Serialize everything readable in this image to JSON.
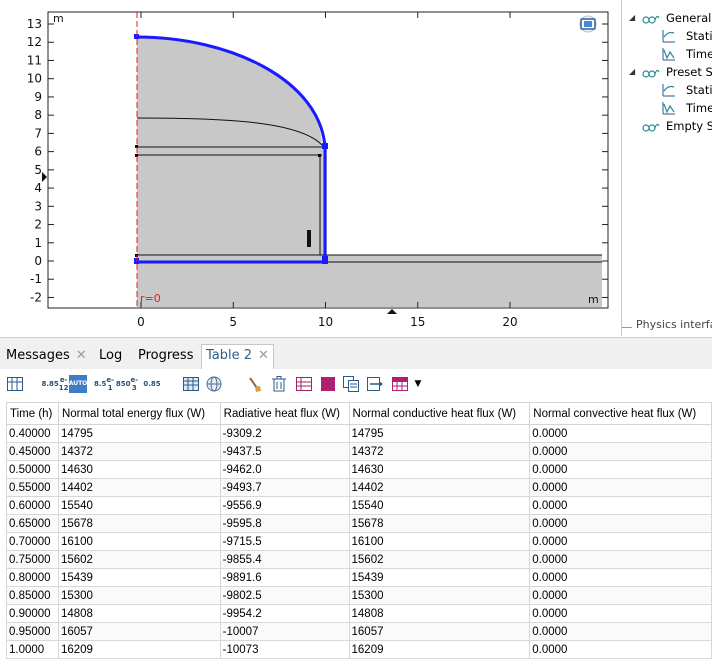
{
  "graphics": {
    "unit_top": "m",
    "unit_right": "m",
    "axis_label": "r=0",
    "y_ticks": [
      "13",
      "12",
      "11",
      "10",
      "9",
      "8",
      "7",
      "6",
      "5",
      "4",
      "3",
      "2",
      "1",
      "0",
      "-1",
      "-2"
    ],
    "x_ticks": [
      "0",
      "5",
      "10",
      "15",
      "20"
    ]
  },
  "tree": {
    "items": [
      {
        "label": "General S",
        "icon": "study-icon",
        "expand": true
      },
      {
        "label": "Statio",
        "icon": "stationary-solver-icon"
      },
      {
        "label": "Time",
        "icon": "time-dependent-icon"
      },
      {
        "label": "Preset Stu",
        "icon": "study-icon",
        "expand": true
      },
      {
        "label": "Statio",
        "icon": "stationary-solver-icon"
      },
      {
        "label": "Time",
        "icon": "time-dependent-icon"
      },
      {
        "label": "Empty St",
        "icon": "study-icon"
      }
    ],
    "physics_label": "Physics interfa"
  },
  "tabs": [
    {
      "label": "Messages",
      "closable": true
    },
    {
      "label": "Log"
    },
    {
      "label": "Progress"
    },
    {
      "label": "Table 2",
      "closable": true,
      "active": true
    }
  ],
  "toolbar": {
    "num1": [
      "8.85",
      "e-12"
    ],
    "num2": "AUTO",
    "num3": [
      "8.5",
      "e-1"
    ],
    "num4": [
      "850",
      "e-3"
    ],
    "num5": "0.85"
  },
  "table": {
    "headers": [
      "Time (h)",
      "Normal total energy flux (W)",
      "Radiative heat flux (W)",
      "Normal conductive heat flux (W)",
      "Normal convective heat flux (W)"
    ],
    "rows": [
      [
        "0.40000",
        "14795",
        "-9309.2",
        "14795",
        "0.0000"
      ],
      [
        "0.45000",
        "14372",
        "-9437.5",
        "14372",
        "0.0000"
      ],
      [
        "0.50000",
        "14630",
        "-9462.0",
        "14630",
        "0.0000"
      ],
      [
        "0.55000",
        "14402",
        "-9493.7",
        "14402",
        "0.0000"
      ],
      [
        "0.60000",
        "15540",
        "-9556.9",
        "15540",
        "0.0000"
      ],
      [
        "0.65000",
        "15678",
        "-9595.8",
        "15678",
        "0.0000"
      ],
      [
        "0.70000",
        "16100",
        "-9715.5",
        "16100",
        "0.0000"
      ],
      [
        "0.75000",
        "15602",
        "-9855.4",
        "15602",
        "0.0000"
      ],
      [
        "0.80000",
        "15439",
        "-9891.6",
        "15439",
        "0.0000"
      ],
      [
        "0.85000",
        "15300",
        "-9802.5",
        "15300",
        "0.0000"
      ],
      [
        "0.90000",
        "14808",
        "-9954.2",
        "14808",
        "0.0000"
      ],
      [
        "0.95000",
        "16057",
        "-10007",
        "16057",
        "0.0000"
      ],
      [
        "1.0000",
        "16209",
        "-10073",
        "16209",
        "0.0000"
      ]
    ]
  },
  "colors": {
    "boundary": "#1a1aff",
    "fill": "#c8c8c8",
    "axis_red": "#e02020",
    "tab_active": "#2d5f8a"
  }
}
